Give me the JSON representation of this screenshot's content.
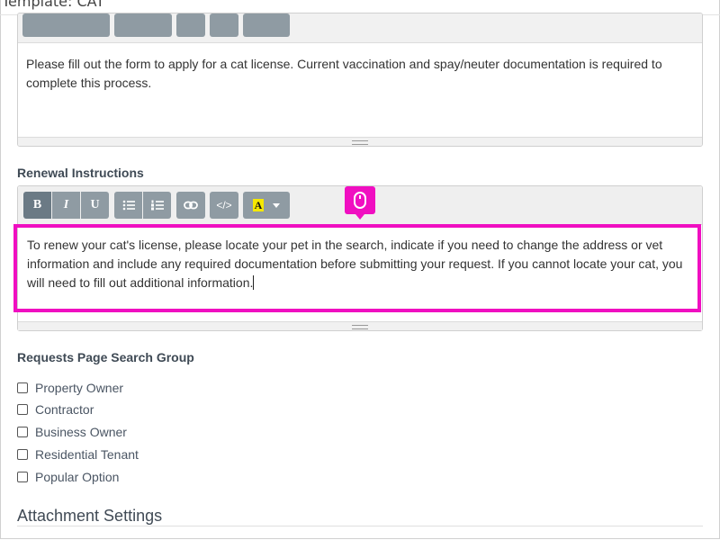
{
  "header": {
    "title": "Template: CAT"
  },
  "editor1": {
    "content": "Please fill out the form to apply for a cat license. Current vaccination and spay/neuter documentation is required to complete this process."
  },
  "renewal": {
    "label": "Renewal Instructions",
    "toolbar": {
      "bold": "B",
      "italic": "I",
      "underline": "U",
      "code": "</>",
      "highlight": "A"
    },
    "content": "To renew your cat's license, please locate your pet in the search, indicate if you need to change the address or vet information and include any required documentation before submitting your request. If you cannot locate your cat, you will need to fill out additional information."
  },
  "search_group": {
    "label": "Requests Page Search Group",
    "options": [
      "Property Owner",
      "Contractor",
      "Business Owner",
      "Residential Tenant",
      "Popular Option"
    ]
  },
  "attachment": {
    "title": "Attachment Settings"
  },
  "colors": {
    "accent": "#f00fc1",
    "toolbar_button": "#8f9ba3"
  }
}
